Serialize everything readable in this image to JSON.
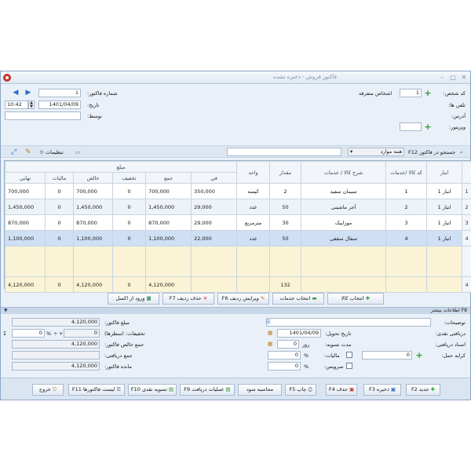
{
  "window": {
    "title": "فاکتور فروش - ذخیره نشده"
  },
  "header_left": {
    "invoice_no_label": "شماره فاکتور:",
    "invoice_no": "1",
    "date_label": "تاریخ:",
    "date": "1401/04/09",
    "time": "10:42",
    "by_label": "توسط:",
    "by": ""
  },
  "header_right": {
    "customer_code_label": "کد شخص:",
    "customer_code": "1",
    "customer_name": "اشخاص متفرقه",
    "phone_label": "تلفن ها:",
    "address_label": "آدرس:",
    "visitor_label": "ویزیتور:"
  },
  "toolbar": {
    "settings_label": "تنظیمات",
    "search_label": "جستجو در فاکتور F12",
    "search_scope": "همه موارد"
  },
  "grid": {
    "amount_group_header": "مبلغ",
    "columns": {
      "warehouse": "انبار",
      "code": "کد کالا /خدمات",
      "description": "شرح کالا / خدمات",
      "qty": "مقدار",
      "unit": "واحد",
      "price": "في",
      "total": "جمع",
      "discount": "تخفيف",
      "net": "خالص",
      "tax": "ماليات",
      "final": "نهايي"
    },
    "rows": [
      {
        "n": "1",
        "warehouse": "انبار 1",
        "code": "1",
        "description": "سیمان سفید",
        "qty": "2",
        "unit": "کیسه",
        "price": "350,000",
        "total": "700,000",
        "discount": "0",
        "net": "700,000",
        "tax": "0",
        "final": "700,000"
      },
      {
        "n": "2",
        "warehouse": "انبار 1",
        "code": "2",
        "description": "آجر ماشینی",
        "qty": "50",
        "unit": "عدد",
        "price": "29,000",
        "total": "1,450,000",
        "discount": "0",
        "net": "1,450,000",
        "tax": "0",
        "final": "1,450,000"
      },
      {
        "n": "3",
        "warehouse": "انبار 1",
        "code": "3",
        "description": "موزاییک",
        "qty": "30",
        "unit": "مترمربع",
        "price": "29,000",
        "total": "870,000",
        "discount": "0",
        "net": "870,000",
        "tax": "0",
        "final": "870,000"
      },
      {
        "n": "4",
        "warehouse": "انبار 1",
        "code": "4",
        "description": "سفال سقفی",
        "qty": "50",
        "unit": "عدد",
        "price": "22,000",
        "total": "1,100,000",
        "discount": "0",
        "net": "1,100,000",
        "tax": "0",
        "final": "1,100,000"
      }
    ],
    "totals": {
      "n": "4",
      "qty": "132",
      "total": "4,120,000",
      "discount": "0",
      "net": "4,120,000",
      "tax": "0",
      "final": "4,120,000"
    }
  },
  "actions": {
    "select_goods": "انتخاب کالا",
    "select_services": "انتخاب خدمات",
    "edit_row": "ویرایش ردیف F6",
    "delete_row": "حذف ردیف F7",
    "import_excel": "ورود از اکسل"
  },
  "more_info": {
    "section_label": "F8 اطلاعات بیشتر",
    "invoice_amount_label": "مبلغ فاکتور:",
    "invoice_amount": "4,120,000",
    "discounts_label": "تخفیفات: (سطرها)",
    "discounts": "0",
    "extra_discount": "0",
    "percent": "%",
    "net_total_label": "جمع خالص فاکتور:",
    "net_total": "4,120,000",
    "received_total_label": "جمع دریافتی:",
    "received_total": "",
    "remaining_label": "مانده فاکتور:",
    "remaining": "4,120,000",
    "notes_label": "توضیحات:",
    "cash_received_label": "دریافتی نقدی:",
    "delivery_date_label": "تاریخ تحویل:",
    "delivery_date": "1401/04/09",
    "receivables_label": "اسناد دریافتی:",
    "settlement_label": "مدت تسویه:",
    "settlement_value": "0",
    "settlement_unit": "روز",
    "freight_label": "کرایه حمل:",
    "freight": "0",
    "tax_label": "مالیات:",
    "tax_value": "0",
    "service_label": "سرویس:",
    "service_value": "0"
  },
  "bottom": {
    "new": "جدید F2",
    "save": "ذخیره F3",
    "delete": "حذف F4",
    "print": "چاپ F5",
    "profit": "محاسبه سود",
    "receive_ops": "عملیات دریافت F9",
    "cash_settle": "تسویه نقدی F10",
    "invoice_list": "لیست فاکتورها F11",
    "exit": "خروج"
  }
}
